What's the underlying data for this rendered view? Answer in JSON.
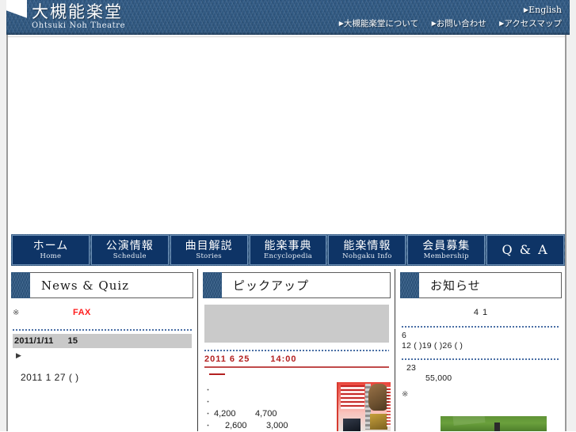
{
  "site": {
    "brand_jp": "大槻能楽堂",
    "brand_en": "Ohtsuki Noh Theatre"
  },
  "toplinks": {
    "english": "English",
    "about": "大槻能楽堂について",
    "contact": "お問い合わせ",
    "access": "アクセスマップ",
    "marker": "▶"
  },
  "nav": [
    {
      "jp": "ホーム",
      "en": "Home"
    },
    {
      "jp": "公演情報",
      "en": "Schedule"
    },
    {
      "jp": "曲目解説",
      "en": "Stories"
    },
    {
      "jp": "能楽事典",
      "en": "Encyclopedia"
    },
    {
      "jp": "能楽情報",
      "en": "Nohgaku Info"
    },
    {
      "jp": "会員募集",
      "en": "Membership"
    },
    {
      "jp": "Q & A",
      "en": ""
    }
  ],
  "left_panel": {
    "title": "News & Quiz",
    "aster": "※",
    "fax_label": "FAX",
    "date_row": "2011/1/11",
    "date_row_num": "15",
    "arrow": "▶",
    "entry": "2011 1 27 ( )"
  },
  "mid_panel": {
    "title": "ピックアップ",
    "event_date": "2011  6  25",
    "event_time": "14:00",
    "prices": [
      {
        "dot": "・",
        "v1": "",
        "v2": ""
      },
      {
        "dot": "・",
        "v1": "",
        "v2": ""
      },
      {
        "dot": "・",
        "v1": "4,200",
        "v2": "4,700"
      },
      {
        "dot": "・",
        "v1": "2,600",
        "v2": "3,000"
      }
    ]
  },
  "right_panel": {
    "title": "お知らせ",
    "heading": "4  1",
    "month": "6",
    "days": "12 ( )19 ( )26 ( )",
    "number": "23",
    "amount": "55,000",
    "aster": "※"
  },
  "colors": {
    "header_blue": "#2f5a86",
    "nav_button": "#0e3466",
    "accent_red": "#b32020",
    "fax_red": "#ff1d1d",
    "gray_bar": "#c9c9c9",
    "green_banner": "#5f9336"
  }
}
